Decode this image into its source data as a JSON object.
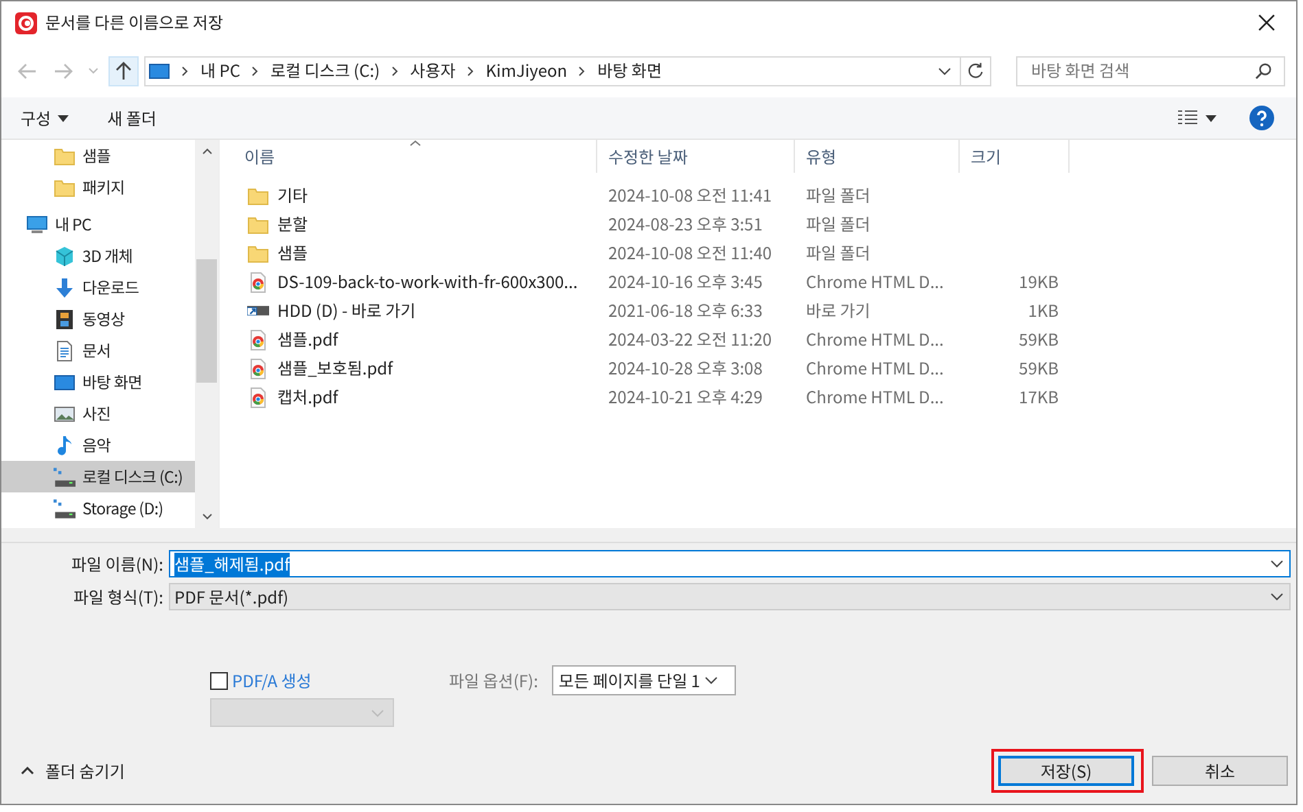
{
  "window": {
    "title": "문서를 다른 이름으로 저장"
  },
  "address_bar": {
    "crumbs": [
      "내 PC",
      "로컬 디스크 (C:)",
      "사용자",
      "KimJiyeon",
      "바탕 화면"
    ]
  },
  "search": {
    "placeholder": "바탕 화면 검색"
  },
  "toolbar": {
    "organize": "구성",
    "new_folder": "새 폴더"
  },
  "sidebar": {
    "pinned_items": [
      {
        "label": "샘플",
        "kind": "folder",
        "selected": false
      },
      {
        "label": "패키지",
        "kind": "folder",
        "selected": false
      }
    ],
    "items": [
      {
        "label": "내 PC",
        "kind": "pc",
        "selected": false,
        "children": [
          {
            "label": "3D 개체",
            "kind": "cube",
            "selected": false
          },
          {
            "label": "다운로드",
            "kind": "download",
            "selected": false
          },
          {
            "label": "동영상",
            "kind": "film",
            "selected": false
          },
          {
            "label": "문서",
            "kind": "document",
            "selected": false
          },
          {
            "label": "바탕 화면",
            "kind": "desktop",
            "selected": false
          },
          {
            "label": "사진",
            "kind": "picture",
            "selected": false
          },
          {
            "label": "음악",
            "kind": "music",
            "selected": false
          },
          {
            "label": "로컬 디스크 (C:)",
            "kind": "drive",
            "selected": true
          },
          {
            "label": "Storage (D:)",
            "kind": "drive",
            "selected": false
          }
        ]
      }
    ]
  },
  "table": {
    "columns": [
      "이름",
      "수정한 날짜",
      "유형",
      "크기"
    ],
    "rows": [
      {
        "kind": "folder",
        "name": "기타",
        "date": "2024-10-08 오전 11:41",
        "type": "파일 폴더",
        "size": ""
      },
      {
        "kind": "folder",
        "name": "분할",
        "date": "2024-08-23 오후 3:51",
        "type": "파일 폴더",
        "size": ""
      },
      {
        "kind": "folder",
        "name": "샘플",
        "date": "2024-10-08 오전 11:40",
        "type": "파일 폴더",
        "size": ""
      },
      {
        "kind": "chrome",
        "name": "DS-109-back-to-work-with-fr-600x300...",
        "date": "2024-10-16 오후 3:45",
        "type": "Chrome HTML D...",
        "size": "19KB"
      },
      {
        "kind": "shortcut",
        "name": "HDD (D) - 바로 가기",
        "date": "2021-06-18 오후 6:33",
        "type": "바로 가기",
        "size": "1KB"
      },
      {
        "kind": "chrome",
        "name": "샘플.pdf",
        "date": "2024-03-22 오전 11:20",
        "type": "Chrome HTML D...",
        "size": "59KB"
      },
      {
        "kind": "chrome",
        "name": "샘플_보호됨.pdf",
        "date": "2024-10-28 오후 3:08",
        "type": "Chrome HTML D...",
        "size": "59KB"
      },
      {
        "kind": "chrome",
        "name": "캡처.pdf",
        "date": "2024-10-21 오후 4:29",
        "type": "Chrome HTML D...",
        "size": "17KB"
      }
    ]
  },
  "form": {
    "file_name_label": "파일 이름(N):",
    "file_name": "샘플_해제됨.pdf",
    "file_type_label": "파일 형식(T):",
    "file_type": "PDF 문서(*.pdf)",
    "pdfa": {
      "label": "PDF/A 생성",
      "checked": false
    },
    "file_option_label": "파일 옵션(F):",
    "file_option": "모든 페이지를 단일 1"
  },
  "hide_folders": "폴더 숨기기",
  "buttons": {
    "save": "저장(S)",
    "cancel": "취소",
    "save_highlighted": true
  }
}
